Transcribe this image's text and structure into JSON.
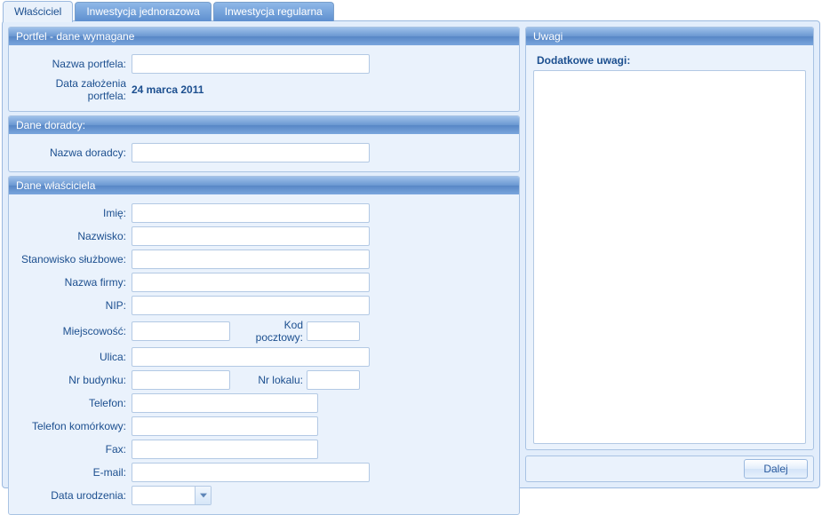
{
  "tabs": {
    "owner": "Właściciel",
    "single_investment": "Inwestycja jednorazowa",
    "regular_investment": "Inwestycja regularna"
  },
  "portfolio": {
    "header": "Portfel - dane wymagane",
    "name_label": "Nazwa portfela:",
    "name_value": "",
    "date_label": "Data założenia portfela:",
    "date_value": "24 marca 2011"
  },
  "advisor": {
    "header": "Dane doradcy:",
    "name_label": "Nazwa doradcy:",
    "name_value": ""
  },
  "owner": {
    "header": "Dane właściciela",
    "first_name_label": "Imię:",
    "last_name_label": "Nazwisko:",
    "position_label": "Stanowisko służbowe:",
    "company_label": "Nazwa firmy:",
    "nip_label": "NIP:",
    "city_label": "Miejscowość:",
    "postal_label": "Kod pocztowy:",
    "street_label": "Ulica:",
    "building_label": "Nr budynku:",
    "apt_label": "Nr lokalu:",
    "phone_label": "Telefon:",
    "mobile_label": "Telefon komórkowy:",
    "fax_label": "Fax:",
    "email_label": "E-mail:",
    "birth_label": "Data urodzenia:",
    "first_name_value": "",
    "last_name_value": "",
    "position_value": "",
    "company_value": "",
    "nip_value": "",
    "city_value": "",
    "postal_value": "",
    "street_value": "",
    "building_value": "",
    "apt_value": "",
    "phone_value": "",
    "mobile_value": "",
    "fax_value": "",
    "email_value": "",
    "birth_value": ""
  },
  "remarks": {
    "header": "Uwagi",
    "label": "Dodatkowe uwagi:",
    "value": ""
  },
  "buttons": {
    "next": "Dalej"
  }
}
